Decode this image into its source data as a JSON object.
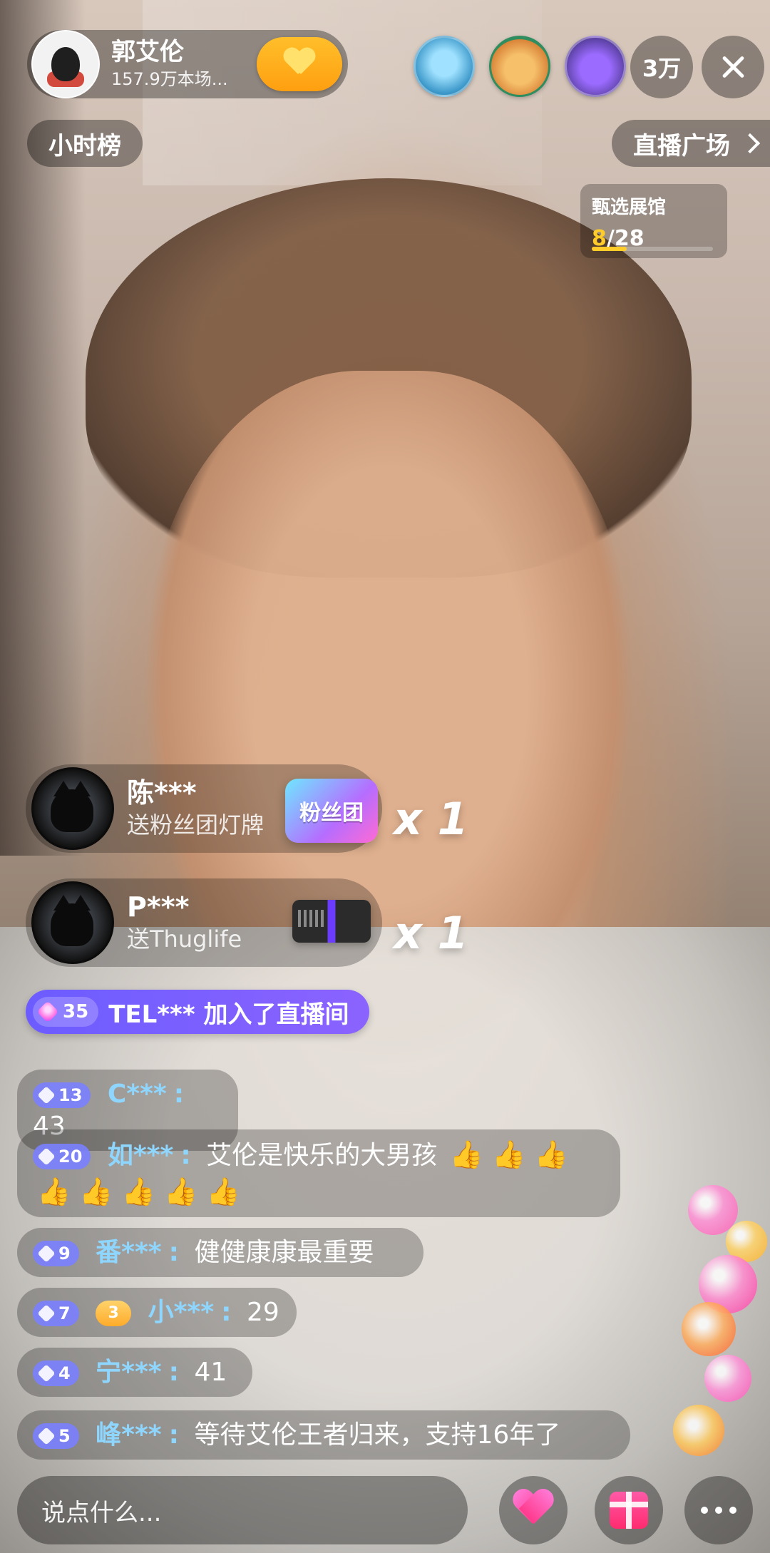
{
  "header": {
    "host_name": "郭艾伦",
    "host_subtitle": "157.9万本场...",
    "viewer_count": "3万"
  },
  "topbar": {
    "hour_rank": "小时榜",
    "live_square": "直播广场"
  },
  "exhibit": {
    "title": "甄选展馆",
    "current": "8",
    "total": "28",
    "progress": 0.2857
  },
  "gifts": [
    {
      "user": "陈***",
      "desc": "送粉丝团灯牌",
      "item_label": "粉丝团",
      "times": "x 1"
    },
    {
      "user": "P***",
      "desc": "送Thuglife",
      "item_label": "",
      "times": "x 1"
    }
  ],
  "join": {
    "level": "35",
    "text": "TEL*** 加入了直播间"
  },
  "chat": [
    {
      "level": "13",
      "name": "C***",
      "sep": ":",
      "message": "43"
    },
    {
      "level": "20",
      "name": "如***",
      "sep": ":",
      "message": "艾伦是快乐的大男孩",
      "thumbs_line1": "👍 👍 👍",
      "thumbs_line2": "👍 👍 👍 👍 👍"
    },
    {
      "level": "9",
      "name": "番***",
      "sep": ":",
      "message": "健健康康最重要"
    },
    {
      "level": "7",
      "fan_badge": "3",
      "name": "小***",
      "sep": ":",
      "message": "29"
    },
    {
      "level": "4",
      "name": "宁***",
      "sep": ":",
      "message": "41"
    },
    {
      "level": "5",
      "name": "峰***",
      "sep": ":",
      "message": "等待艾伦王者归来，支持16年了"
    }
  ],
  "bottombar": {
    "input_placeholder": "说点什么..."
  },
  "icons": {
    "close": "close-icon",
    "follow": "heart-icon",
    "like": "heart-icon",
    "gift": "gift-icon",
    "more": "more-icon",
    "chevron": "chevron-right-icon"
  }
}
